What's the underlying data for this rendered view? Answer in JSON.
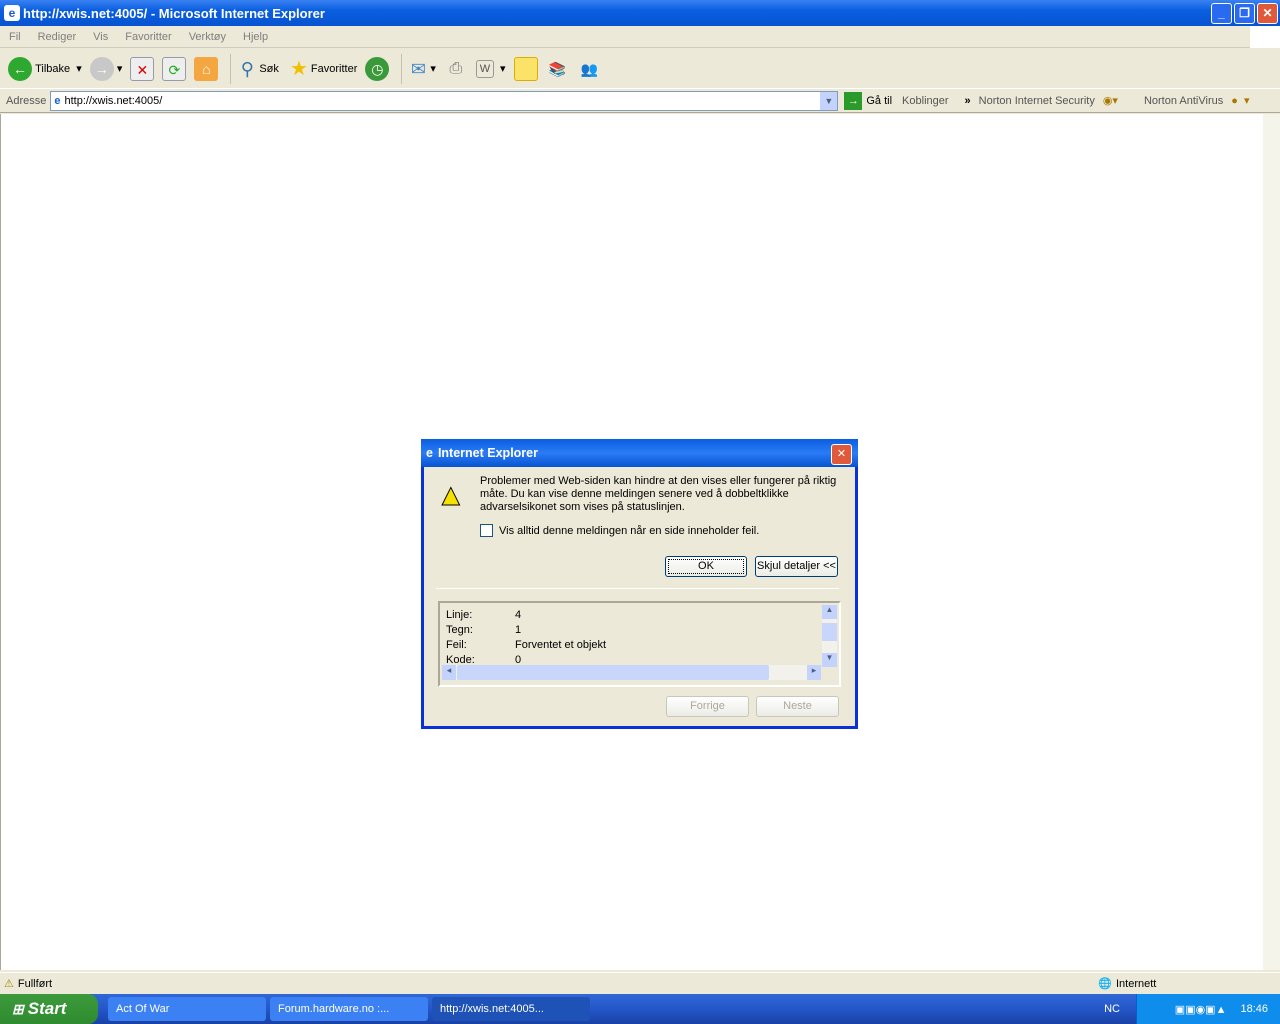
{
  "window": {
    "title": "http://xwis.net:4005/ - Microsoft Internet Explorer"
  },
  "menu": [
    "Fil",
    "Rediger",
    "Vis",
    "Favoritter",
    "Verktøy",
    "Hjelp"
  ],
  "toolbar": {
    "back": "Tilbake",
    "search": "Søk",
    "favorites": "Favoritter"
  },
  "address": {
    "label": "Adresse",
    "url": "http://xwis.net:4005/",
    "go": "Gå til",
    "links": "Koblinger",
    "nis": "Norton Internet Security",
    "nav": "Norton AntiVirus"
  },
  "status": {
    "text": "Fullført",
    "zone": "Internett"
  },
  "taskbar": {
    "start": "Start",
    "tasks": [
      "Act Of War",
      "Forum.hardware.no :...",
      "http://xwis.net:4005..."
    ],
    "lang": "NC",
    "clock": "18:46"
  },
  "dialog": {
    "title": "Internet Explorer",
    "message": "Problemer med Web-siden kan hindre at den vises eller fungerer på riktig måte. Du kan vise denne meldingen senere ved å dobbeltklikke advarselsikonet som vises på statuslinjen.",
    "checkbox": "Vis alltid denne meldingen når en side inneholder feil.",
    "ok": "OK",
    "details": "Skjul detaljer <<",
    "rows": [
      {
        "k": "Linje:",
        "v": "4"
      },
      {
        "k": "Tegn:",
        "v": "1"
      },
      {
        "k": "Feil:",
        "v": "Forventet et objekt"
      },
      {
        "k": "Kode:",
        "v": "0"
      }
    ],
    "prev": "Forrige",
    "next": "Neste"
  }
}
